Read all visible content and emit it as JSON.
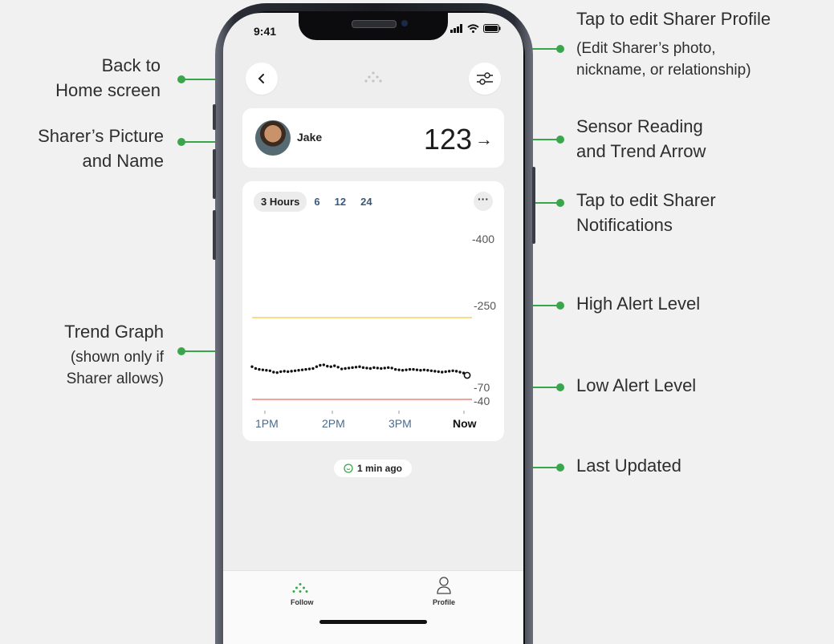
{
  "annotations": {
    "back": [
      "Back to",
      "Home screen"
    ],
    "sharer_picture": [
      "Sharer’s Picture",
      "and Name"
    ],
    "trend_graph": "Trend Graph",
    "trend_graph_note": [
      "(shown only if",
      "Sharer allows)"
    ],
    "edit_profile": "Tap to edit Sharer Profile",
    "edit_profile_note": [
      "(Edit Sharer’s photo,",
      "nickname, or relationship)"
    ],
    "sensor_reading": [
      "Sensor Reading",
      "and Trend Arrow"
    ],
    "edit_notifications": [
      "Tap to edit Sharer",
      "Notifications"
    ],
    "high_alert": "High Alert Level",
    "low_alert": "Low Alert Level",
    "last_updated": "Last Updated"
  },
  "status_bar": {
    "time": "9:41"
  },
  "sharer": {
    "name": "Jake",
    "reading": "123",
    "trend_arrow": "→"
  },
  "graph": {
    "tabs": [
      "3 Hours",
      "6",
      "12",
      "24"
    ],
    "selected_tab": "3 Hours",
    "more_label": "···",
    "y_labels": {
      "top": "400",
      "high": "250",
      "low": "70",
      "bottom": "40"
    },
    "x_labels": [
      "1PM",
      "2PM",
      "3PM",
      "Now"
    ],
    "colors": {
      "high_line": "#f5c542",
      "low_line": "#e86b5f",
      "points": "#111111"
    }
  },
  "chart_data": {
    "type": "scatter",
    "x": [
      0,
      3,
      6,
      9,
      12,
      15,
      18,
      21,
      24,
      27,
      30,
      33,
      36,
      39,
      42,
      45,
      48,
      51,
      54,
      57,
      60,
      63,
      66,
      69,
      72,
      75,
      78,
      81,
      84,
      87,
      90,
      93,
      96,
      99,
      102,
      105,
      108,
      111,
      114,
      117,
      120,
      123,
      126,
      129,
      132,
      135,
      138,
      141,
      144,
      147,
      150,
      153,
      156,
      159,
      162,
      165,
      168,
      171,
      174,
      177,
      180
    ],
    "y": [
      142,
      138,
      136,
      135,
      134,
      133,
      130,
      129,
      131,
      132,
      131,
      132,
      133,
      134,
      135,
      136,
      137,
      138,
      142,
      145,
      146,
      143,
      142,
      144,
      141,
      137,
      138,
      139,
      140,
      141,
      142,
      140,
      139,
      138,
      140,
      139,
      138,
      139,
      140,
      139,
      136,
      135,
      134,
      135,
      136,
      136,
      135,
      134,
      135,
      134,
      133,
      132,
      131,
      130,
      131,
      132,
      133,
      132,
      130,
      128,
      123
    ],
    "xlabel": "",
    "ylabel": "",
    "ylim": [
      40,
      400
    ],
    "high_alert": 250,
    "low_alert": 70,
    "last_point_hollow": true
  },
  "last_updated": "1 min ago",
  "tabbar": {
    "follow": "Follow",
    "profile": "Profile"
  },
  "accent": "#3aa64c"
}
